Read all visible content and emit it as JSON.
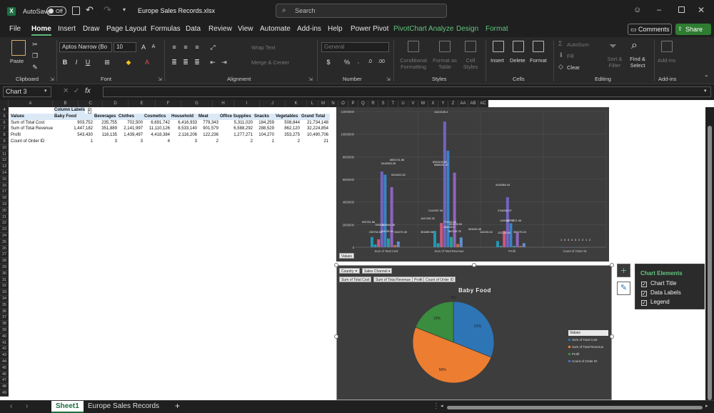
{
  "titlebar": {
    "autosave_label": "AutoSave",
    "autosave_state": "Off",
    "filename": "Europe Sales Records.xlsx",
    "search_placeholder": "Search"
  },
  "menu": {
    "tabs": [
      "File",
      "Home",
      "Insert",
      "Draw",
      "Page Layout",
      "Formulas",
      "Data",
      "Review",
      "View",
      "Automate",
      "Add-ins",
      "Help",
      "Power Pivot",
      "PivotChart Analyze",
      "Design",
      "Format"
    ],
    "comments": "Comments",
    "share": "Share"
  },
  "ribbon": {
    "paste": "Paste",
    "clipboard": "Clipboard",
    "font_name": "Aptos Narrow (Bo",
    "font_size": "10",
    "font": "Font",
    "wrap_text": "Wrap Text",
    "merge_center": "Merge & Center",
    "alignment": "Alignment",
    "number_format": "General",
    "number": "Number",
    "conditional_formatting": "Conditional Formatting",
    "format_as_table": "Format as Table",
    "cell_styles": "Cell Styles",
    "styles": "Styles",
    "insert": "Insert",
    "delete": "Delete",
    "format": "Format",
    "cells": "Cells",
    "autosum": "AutoSum",
    "fill": "Fill",
    "clear": "Clear",
    "sort_filter": "Sort & Filter",
    "find_select": "Find & Select",
    "editing": "Editing",
    "addins_btn": "Add-ins",
    "addins": "Add-ins"
  },
  "formula_bar": {
    "name_box": "Chart 3",
    "fx": "fx",
    "formula": ""
  },
  "columns": [
    "A",
    "B",
    "C",
    "D",
    "E",
    "F",
    "G",
    "H",
    "I",
    "J",
    "K",
    "L",
    "M",
    "N",
    "O",
    "P",
    "Q",
    "R",
    "S",
    "T",
    "U",
    "V",
    "W",
    "X",
    "Y",
    "Z",
    "AA",
    "AB",
    "AC"
  ],
  "rows": [
    "4",
    "5",
    "6",
    "7",
    "8",
    "9",
    "10",
    "11",
    "12",
    "13",
    "14",
    "15",
    "16",
    "17",
    "18",
    "19",
    "20",
    "21",
    "22",
    "23",
    "24",
    "25",
    "26",
    "27",
    "28",
    "29",
    "30",
    "31",
    "32",
    "33",
    "34",
    "35",
    "36",
    "37",
    "38",
    "39",
    "40",
    "41",
    "42",
    "43",
    "44",
    "45",
    "46",
    "47",
    "48",
    "49"
  ],
  "pivot": {
    "column_labels": "Column Labels",
    "values_header": "Values",
    "headers": [
      "Baby Food",
      "Beverages",
      "Clothes",
      "Cosmetics",
      "Household",
      "Meat",
      "Office Supplies",
      "Snacks",
      "Vegetables",
      "Grand Total"
    ],
    "rows": [
      {
        "label": "Sum of Total Cost",
        "values": [
          "903,752",
          "235,755",
          "702,500",
          "6,691,742",
          "6,416,933",
          "779,343",
          "5,311,020",
          "184,259",
          "508,844",
          "21,734,148"
        ]
      },
      {
        "label": "Sum of Total Revenue",
        "values": [
          "1,447,182",
          "351,889",
          "2,141,997",
          "11,110,126",
          "8,533,140",
          "901,579",
          "6,588,292",
          "288,529",
          "862,120",
          "32,224,854"
        ]
      },
      {
        "label": "Profit",
        "values": [
          "543,430",
          "116,135",
          "1,439,497",
          "4,418,384",
          "2,116,206",
          "122,236",
          "1,277,271",
          "104,270",
          "353,275",
          "10,490,706"
        ]
      },
      {
        "label": "Count of Order ID",
        "values": [
          "1",
          "3",
          "3",
          "4",
          "3",
          "2",
          "2",
          "1",
          "2",
          "21"
        ]
      }
    ]
  },
  "chart1": {
    "values_button": "Values",
    "yticks": [
      "12000000",
      "10000000",
      "8000000",
      "6000000",
      "4000000",
      "2000000",
      "0"
    ],
    "categories": [
      "Sum of Total Cost",
      "Sum of Total Revenue",
      "Profit",
      "Count of Order ID"
    ],
    "labels": [
      "11110126.4",
      "8533139.63",
      "6691741.86",
      "6416933.28",
      "5311020.32",
      "6588291.37",
      "4418384.44",
      "2141997.36",
      "2116206.37",
      "1447182.32",
      "1439497.42",
      "1277271.06",
      "903751.86",
      "702500",
      "779342.50",
      "901578.90",
      "543430.35",
      "862119.76",
      "235754.64",
      "351889.08",
      "184259.54",
      "508844.38",
      "288528.9",
      "116135.04",
      "122235.84",
      "353275.24",
      "104270.45"
    ],
    "count_labels": [
      "1",
      "3",
      "3",
      "4",
      "3",
      "2",
      "2",
      "1",
      "2"
    ]
  },
  "chart2": {
    "filters": [
      "Country",
      "Sales Channel"
    ],
    "value_buttons": [
      "Sum of Total Cost",
      "Sum of Total Revenue",
      "Profit",
      "Count of Order ID"
    ],
    "title": "Baby Food",
    "slices": [
      {
        "name": "Sum of Total Cost",
        "pct": "31%",
        "value": 0.31,
        "color": "#2e75b6"
      },
      {
        "name": "Sum of Total Revenue",
        "pct": "50%",
        "value": 0.5,
        "color": "#ed7d31"
      },
      {
        "name": "Profit",
        "pct": "19%",
        "value": 0.19,
        "color": "#3a8c3e"
      },
      {
        "name": "Count of Order ID",
        "pct": "0%",
        "value": 0.0,
        "color": "#4472c4"
      }
    ],
    "legend_title": "Values"
  },
  "chart_elements": {
    "title": "Chart Elements",
    "items": [
      "Chart Title",
      "Data Labels",
      "Legend"
    ]
  },
  "sheets": [
    "Sheet1",
    "Europe Sales Records"
  ],
  "colors": {
    "accent": "#5fb978",
    "share": "#2e7d32"
  }
}
